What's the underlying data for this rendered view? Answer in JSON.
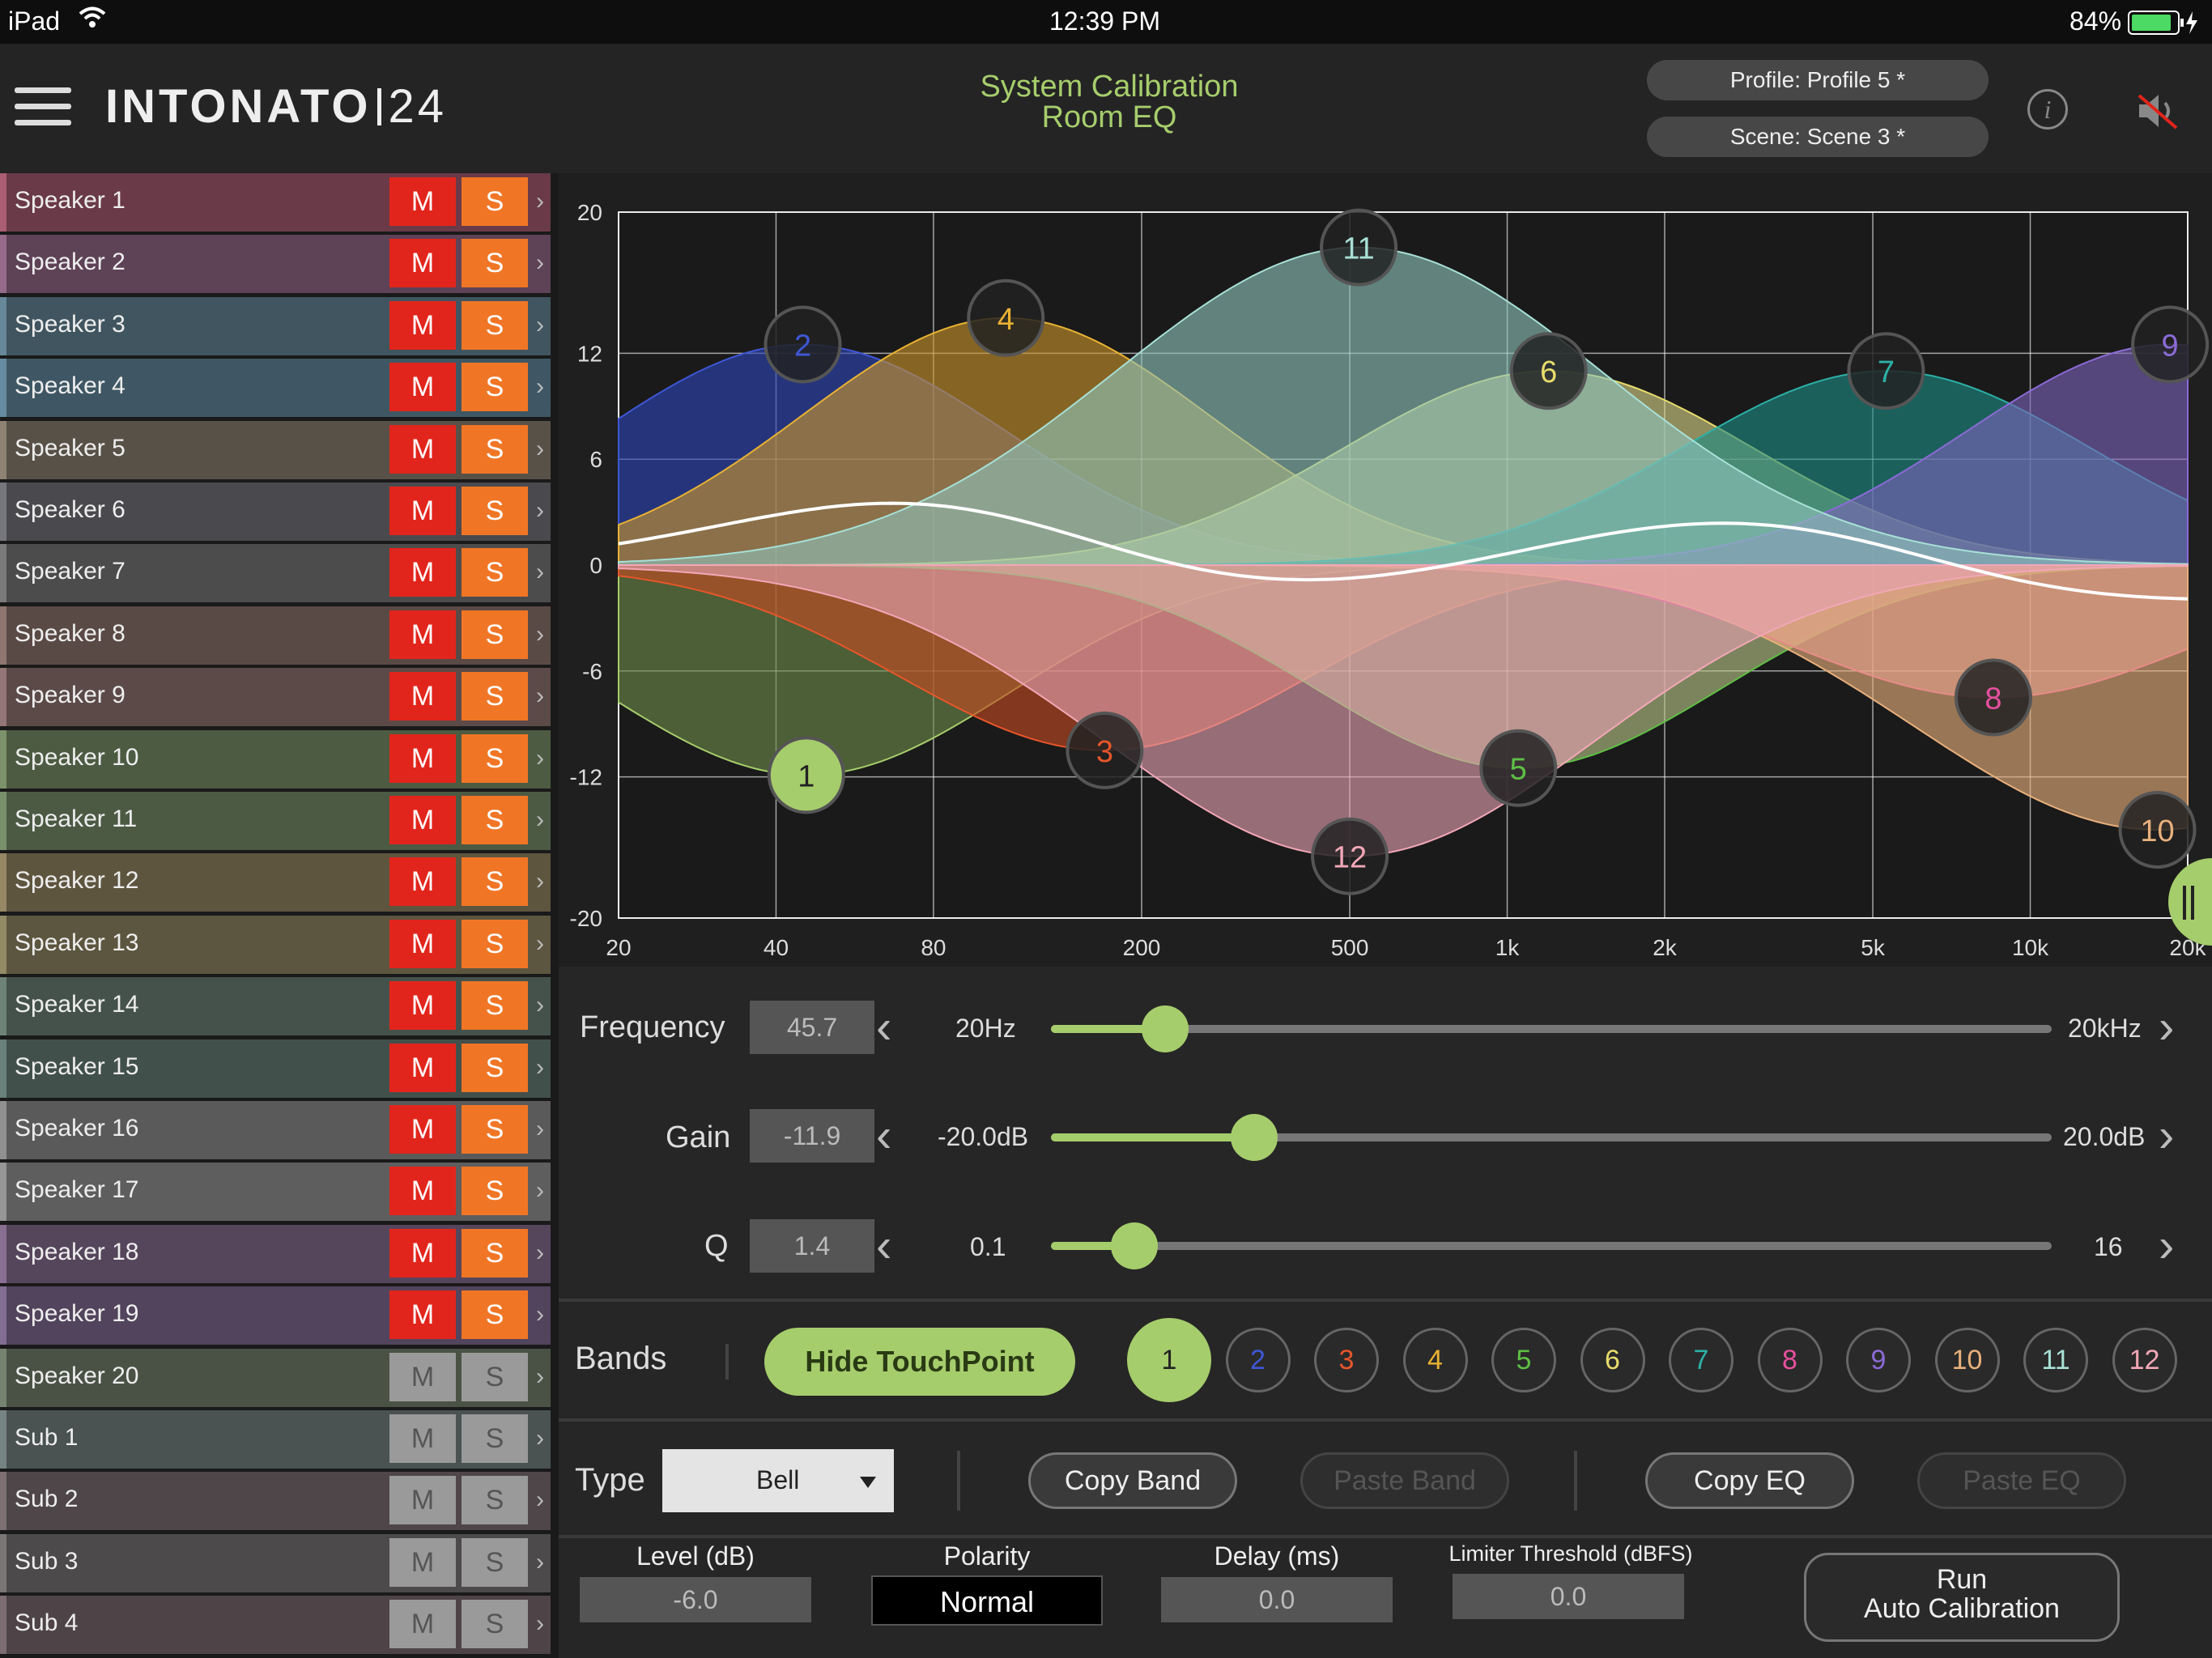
{
  "status": {
    "device": "iPad",
    "time": "12:39 PM",
    "battery": "84%"
  },
  "header": {
    "logo": "INTONATO",
    "logo_suffix": "24",
    "title_line1": "System Calibration",
    "title_line2": "Room EQ",
    "profile": "Profile: Profile 5 *",
    "scene": "Scene: Scene 3 *",
    "icons": {
      "menu": "hamburger-menu-icon",
      "info": "info-icon",
      "mute": "speaker-muted-icon"
    }
  },
  "speakers": [
    {
      "name": "Speaker 1",
      "m": "M",
      "s": "S",
      "active": true,
      "color": "#6a3a48"
    },
    {
      "name": "Speaker 2",
      "m": "M",
      "s": "S",
      "active": true,
      "color": "#5e4256"
    },
    {
      "name": "Speaker 3",
      "m": "M",
      "s": "S",
      "active": true,
      "color": "#40555f"
    },
    {
      "name": "Speaker 4",
      "m": "M",
      "s": "S",
      "active": true,
      "color": "#3f5764"
    },
    {
      "name": "Speaker 5",
      "m": "M",
      "s": "S",
      "active": true,
      "color": "#585148"
    },
    {
      "name": "Speaker 6",
      "m": "M",
      "s": "S",
      "active": true,
      "color": "#4a4a4e"
    },
    {
      "name": "Speaker 7",
      "m": "M",
      "s": "S",
      "active": true,
      "color": "#4c4c4c"
    },
    {
      "name": "Speaker 8",
      "m": "M",
      "s": "S",
      "active": true,
      "color": "#5a4a46"
    },
    {
      "name": "Speaker 9",
      "m": "M",
      "s": "S",
      "active": true,
      "color": "#5c4a49"
    },
    {
      "name": "Speaker 10",
      "m": "M",
      "s": "S",
      "active": true,
      "color": "#4d5b42"
    },
    {
      "name": "Speaker 11",
      "m": "M",
      "s": "S",
      "active": true,
      "color": "#4c5a44"
    },
    {
      "name": "Speaker 12",
      "m": "M",
      "s": "S",
      "active": true,
      "color": "#5e553f"
    },
    {
      "name": "Speaker 13",
      "m": "M",
      "s": "S",
      "active": true,
      "color": "#5c5640"
    },
    {
      "name": "Speaker 14",
      "m": "M",
      "s": "S",
      "active": true,
      "color": "#45524b"
    },
    {
      "name": "Speaker 15",
      "m": "M",
      "s": "S",
      "active": true,
      "color": "#42504c"
    },
    {
      "name": "Speaker 16",
      "m": "M",
      "s": "S",
      "active": true,
      "color": "#5a5a5a"
    },
    {
      "name": "Speaker 17",
      "m": "M",
      "s": "S",
      "active": true,
      "color": "#5e5e5e"
    },
    {
      "name": "Speaker 18",
      "m": "M",
      "s": "S",
      "active": true,
      "color": "#55465c"
    },
    {
      "name": "Speaker 19",
      "m": "M",
      "s": "S",
      "active": true,
      "color": "#51445c"
    },
    {
      "name": "Speaker 20",
      "m": "M",
      "s": "S",
      "active": false,
      "color": "#4a5246"
    },
    {
      "name": "Sub 1",
      "m": "M",
      "s": "S",
      "active": false,
      "color": "#4a5252"
    },
    {
      "name": "Sub 2",
      "m": "M",
      "s": "S",
      "active": false,
      "color": "#4e4648"
    },
    {
      "name": "Sub 3",
      "m": "M",
      "s": "S",
      "active": false,
      "color": "#4c4a4a"
    },
    {
      "name": "Sub 4",
      "m": "M",
      "s": "S",
      "active": false,
      "color": "#4e4448"
    }
  ],
  "plot": {
    "y_ticks": [
      "20",
      "12",
      "6",
      "0",
      "-6",
      "-12",
      "-20"
    ],
    "x_ticks": [
      "20",
      "40",
      "80",
      "200",
      "500",
      "1k",
      "2k",
      "5k",
      "10k",
      "20k"
    ]
  },
  "bands": [
    {
      "id": "1",
      "freq": 45.7,
      "gain": -11.9,
      "color": "#a6cd6c",
      "fill": "#6d8a48"
    },
    {
      "id": "2",
      "freq": 45,
      "gain": 12.5,
      "color": "#3f57d6",
      "fill": "#2e47b8"
    },
    {
      "id": "3",
      "freq": 170,
      "gain": -10.5,
      "color": "#e6562b",
      "fill": "#c54a22"
    },
    {
      "id": "4",
      "freq": 110,
      "gain": 14,
      "color": "#e9b233",
      "fill": "#c9952c"
    },
    {
      "id": "5",
      "freq": 1050,
      "gain": -11.5,
      "color": "#5fbf45",
      "fill": "#b8c787"
    },
    {
      "id": "6",
      "freq": 1200,
      "gain": 11,
      "color": "#e8dc6c",
      "fill": "#d8d487"
    },
    {
      "id": "7",
      "freq": 5300,
      "gain": 11,
      "color": "#2db1a7",
      "fill": "#1e8c86"
    },
    {
      "id": "8",
      "freq": 8500,
      "gain": -7.5,
      "color": "#e6509e",
      "fill": "#e28aa3"
    },
    {
      "id": "9",
      "freq": 18500,
      "gain": 12.5,
      "color": "#8b6bd6",
      "fill": "#7a62b8"
    },
    {
      "id": "10",
      "freq": 17500,
      "gain": -15,
      "color": "#e8b07c",
      "fill": "#e8b07c"
    },
    {
      "id": "11",
      "freq": 520,
      "gain": 18,
      "color": "#a8e0d6",
      "fill": "#8ec3bb"
    },
    {
      "id": "12",
      "freq": 500,
      "gain": -16.5,
      "color": "#f2a7b6",
      "fill": "#e5a2b2"
    }
  ],
  "controls": {
    "frequency": {
      "label": "Frequency",
      "value": "45.7",
      "min": "20Hz",
      "max": "20kHz",
      "position": 0.114
    },
    "gain": {
      "label": "Gain",
      "value": "-11.9",
      "min": "-20.0dB",
      "max": "20.0dB",
      "position": 0.203
    },
    "q": {
      "label": "Q",
      "value": "1.4",
      "min": "0.1",
      "max": "16",
      "position": 0.083
    }
  },
  "bandsbar": {
    "label": "Bands",
    "hide_touchpoint": "Hide TouchPoint",
    "selected": "1",
    "buttons": [
      "1",
      "2",
      "3",
      "4",
      "5",
      "6",
      "7",
      "8",
      "9",
      "10",
      "11",
      "12"
    ]
  },
  "typebar": {
    "label": "Type",
    "type_value": "Bell",
    "copy_band": "Copy Band",
    "paste_band": "Paste Band",
    "copy_eq": "Copy EQ",
    "paste_eq": "Paste EQ"
  },
  "bottom": {
    "level_label": "Level (dB)",
    "level_value": "-6.0",
    "polarity_label": "Polarity",
    "polarity_value": "Normal",
    "delay_label": "Delay (ms)",
    "delay_value": "0.0",
    "limiter_label": "Limiter Threshold (dBFS)",
    "limiter_value": "0.0",
    "run_line1": "Run",
    "run_line2": "Auto Calibration"
  }
}
